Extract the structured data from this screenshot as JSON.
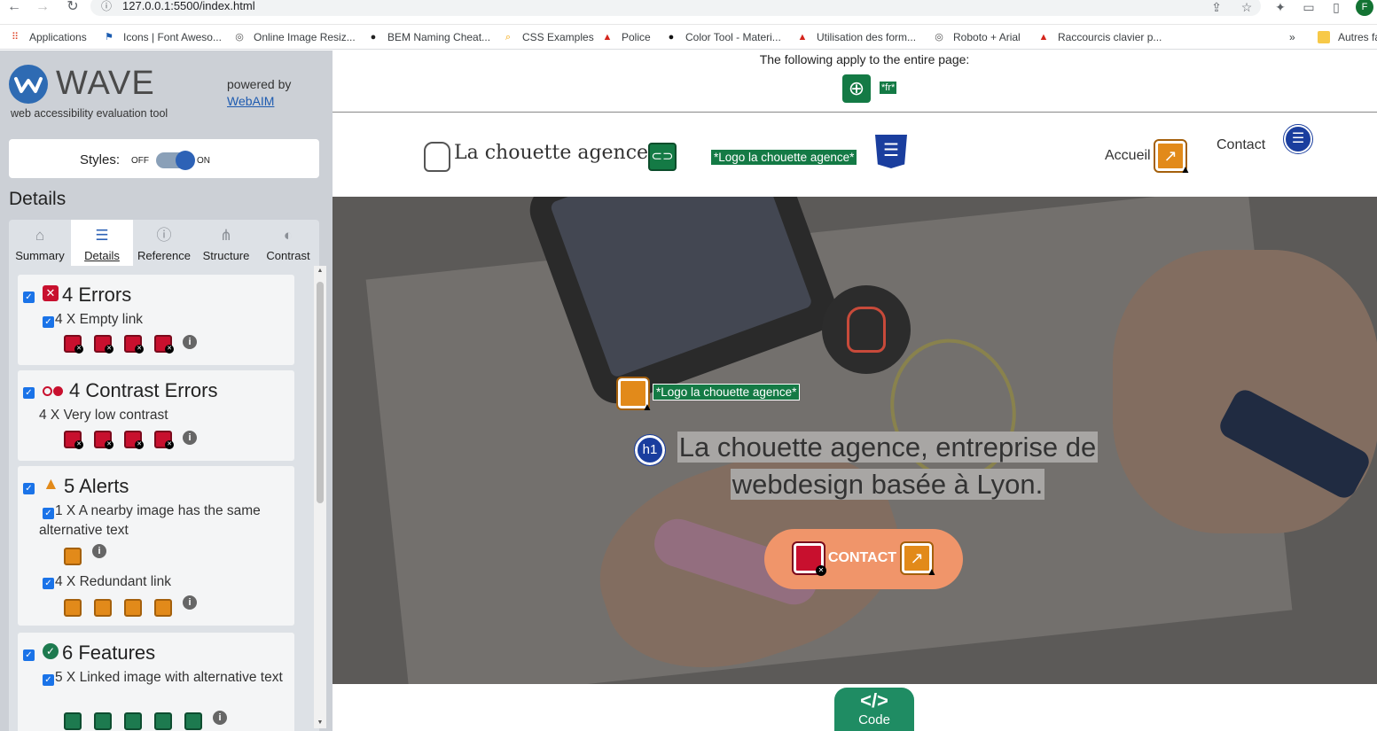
{
  "browser": {
    "url": "127.0.0.1:5500/index.html",
    "avatar_letter": "F",
    "bookmarks": [
      "Applications",
      "Icons | Font Aweso...",
      "Online Image Resiz...",
      "BEM Naming Cheat...",
      "CSS Examples",
      "Police",
      "Color Tool - Materi...",
      "Utilisation des form...",
      "Roboto + Arial",
      "Raccourcis clavier p...",
      "Autres fa"
    ],
    "overflow": "»"
  },
  "wave": {
    "brand": "WAVE",
    "tagline": "web accessibility evaluation tool",
    "powered_by": "powered by",
    "webaim": "WebAIM",
    "styles_label": "Styles:",
    "styles_off": "OFF",
    "styles_on": "ON",
    "styles_enabled": true,
    "details_heading": "Details",
    "tabs": [
      "Summary",
      "Details",
      "Reference",
      "Structure",
      "Contrast"
    ],
    "active_tab": "Details",
    "errors": {
      "title": "4 Errors",
      "item": "4 X Empty link",
      "count": 4
    },
    "contrast": {
      "title": "4 Contrast Errors",
      "item": "4 X Very low contrast",
      "count": 4
    },
    "alerts": {
      "title": "5 Alerts",
      "item1": "1 X A nearby image has the same alternative text",
      "item2": "4 X Redundant link"
    },
    "features": {
      "title": "6 Features",
      "item1": "5 X Linked image with alternative text"
    },
    "info_glyph": "i"
  },
  "page": {
    "apply_note": "The following apply to the entire page:",
    "lang_tag": "*fr*",
    "brand_name": "La chouette agence",
    "logo_alt": "*Logo la chouette agence*",
    "nav": [
      "Accueil",
      "Contact"
    ],
    "hero_alt": "*Logo la chouette agence*",
    "h1_badge": "h1",
    "h1": "La chouette agence, entreprise de webdesign basée à Lyon.",
    "cta": "CONTACT",
    "code_label": "Code",
    "code_symbol": "</>"
  },
  "colors": {
    "wave_bg": "#ccd0d6",
    "error_red": "#c8102e",
    "alert_orange": "#e28a1a",
    "feature_green": "#147a45",
    "structure_blue": "#1a3e9e",
    "cta": "#f0956a"
  }
}
